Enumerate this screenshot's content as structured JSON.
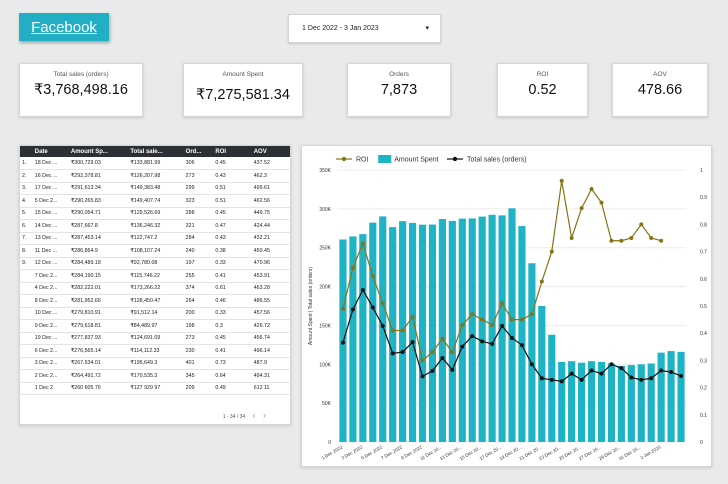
{
  "header": {
    "facebook_label": "Facebook"
  },
  "date_range": {
    "label": "1 Dec 2022 - 3 Jan 2023",
    "arrow": "▾"
  },
  "kpis": [
    {
      "label": "Total sales (orders)",
      "value": "₹3,768,498.16"
    },
    {
      "label": "Amount Spent",
      "value": "₹7,275,581.34"
    },
    {
      "label": "Orders",
      "value": "7,873"
    },
    {
      "label": "ROI",
      "value": "0.52"
    },
    {
      "label": "AOV",
      "value": "478.66"
    }
  ],
  "table": {
    "headers": [
      "",
      "Date",
      "Amount Sp...",
      "Total sale...",
      "Ord...",
      "ROI",
      "AOV"
    ],
    "rows": [
      [
        "1.",
        "18 Dec ...",
        "₹300,729.03",
        "₹133,881.99",
        "306",
        "0.45",
        "437.52"
      ],
      [
        "2.",
        "16 Dec ...",
        "₹292,378.81",
        "₹126,207.98",
        "273",
        "0.43",
        "462.3"
      ],
      [
        "3.",
        "17 Dec ...",
        "₹291,613.34",
        "₹149,383.48",
        "299",
        "0.51",
        "499.61"
      ],
      [
        "4.",
        "5 Dec 2...",
        "₹290,265.83",
        "₹149,407.74",
        "323",
        "0.51",
        "462.56"
      ],
      [
        "5.",
        "15 Dec ...",
        "₹290,054.71",
        "₹129,526.69",
        "288",
        "0.45",
        "449.75"
      ],
      [
        "6.",
        "14 Dec ...",
        "₹287,667.8",
        "₹136,246.32",
        "321",
        "0.47",
        "424.44"
      ],
      [
        "7.",
        "13 Dec ...",
        "₹287,453.14",
        "₹122,747.2",
        "284",
        "0.43",
        "432.21"
      ],
      [
        "8.",
        "11 Dec ...",
        "₹286,864.9",
        "₹108,107.24",
        "240",
        "0.38",
        "450.45"
      ],
      [
        "9.",
        "12 Dec ...",
        "₹284,489.18",
        "₹92,780.08",
        "197",
        "0.33",
        "470.96"
      ],
      [
        "",
        "7 Dec 2...",
        "₹284,190.15",
        "₹115,746.22",
        "255",
        "0.41",
        "453.91"
      ],
      [
        "",
        "4 Dec 2...",
        "₹282,222.01",
        "₹173,266.22",
        "374",
        "0.61",
        "463.28"
      ],
      [
        "",
        "8 Dec 2...",
        "₹281,952.66",
        "₹128,450.47",
        "264",
        "0.46",
        "486.55"
      ],
      [
        "",
        "10 Dec ...",
        "₹279,810.91",
        "₹91,512.14",
        "200",
        "0.33",
        "457.56"
      ],
      [
        "",
        "9 Dec 2...",
        "₹279,618.81",
        "₹84,489.97",
        "198",
        "0.3",
        "426.72"
      ],
      [
        "",
        "19 Dec ...",
        "₹277,837.93",
        "₹124,691.09",
        "273",
        "0.45",
        "456.74"
      ],
      [
        "",
        "6 Dec 2...",
        "₹276,565.14",
        "₹114,112.33",
        "230",
        "0.41",
        "496.14"
      ],
      [
        "",
        "3 Dec 2...",
        "₹267,534.01",
        "₹195,649.3",
        "401",
        "0.73",
        "487.9"
      ],
      [
        "",
        "2 Dec 2...",
        "₹264,491.72",
        "₹170,535.3",
        "345",
        "0.64",
        "494.31"
      ],
      [
        "",
        "1 Dec 2",
        "₹260 605 76",
        "₹127 929 97",
        "209",
        "0.49",
        "612 11"
      ]
    ],
    "pager": "1 - 34 / 34",
    "prev": "‹",
    "next": "›"
  },
  "chart_data": {
    "type": "bar",
    "legend": [
      "ROI",
      "Amount Spent",
      "Total sales (orders)"
    ],
    "ylabel": "Amount Spent | Total sales (orders)",
    "left_axis": {
      "min": 0,
      "max": 350000,
      "ticks": [
        "0",
        "50K",
        "100K",
        "150K",
        "200K",
        "250K",
        "300K",
        "350K"
      ]
    },
    "right_axis": {
      "min": 0,
      "max": 1,
      "ticks": [
        "0",
        "0.1",
        "0.2",
        "0.3",
        "0.4",
        "0.5",
        "0.6",
        "0.7",
        "0.8",
        "0.9",
        "1"
      ]
    },
    "x_tick_labels": [
      "1 Dec 2022",
      "3 Dec 2022",
      "5 Dec 2022",
      "7 Dec 2022",
      "9 Dec 2022",
      "11 Dec 20...",
      "13 Dec 20...",
      "15 Dec 20...",
      "17 Dec 20...",
      "19 Dec 20...",
      "21 Dec 20...",
      "23 Dec 20...",
      "25 Dec 20...",
      "27 Dec 20...",
      "29 Dec 20...",
      "31 Dec 20...",
      "2 Jan 2023"
    ],
    "amount_spent": [
      260605,
      264492,
      267534,
      282222,
      290266,
      276565,
      284190,
      281953,
      279619,
      279811,
      286865,
      284489,
      287453,
      287668,
      290055,
      292379,
      291613,
      300729,
      277838,
      230000,
      175000,
      138000,
      103000,
      104000,
      102000,
      104000,
      103000,
      101000,
      98000,
      99000,
      100000,
      101000,
      115000,
      117000,
      116000
    ],
    "total_sales": [
      127930,
      170535,
      195649,
      173266,
      149408,
      114112,
      115746,
      128450,
      84490,
      91512,
      108107,
      92780,
      122747,
      136246,
      129527,
      126208,
      149383,
      133882,
      124691,
      100000,
      82000,
      80000,
      78000,
      88000,
      80000,
      92000,
      88000,
      100000,
      95000,
      83000,
      80000,
      82000,
      92000,
      90000,
      85000
    ],
    "roi": [
      0.49,
      0.64,
      0.73,
      0.61,
      0.51,
      0.41,
      0.41,
      0.46,
      0.3,
      0.33,
      0.38,
      0.33,
      0.43,
      0.47,
      0.45,
      0.43,
      0.51,
      0.45,
      0.45,
      0.47,
      0.59,
      0.7,
      0.96,
      0.75,
      0.86,
      0.93,
      0.88,
      0.74,
      0.74,
      0.75,
      0.8,
      0.75,
      0.74
    ]
  }
}
